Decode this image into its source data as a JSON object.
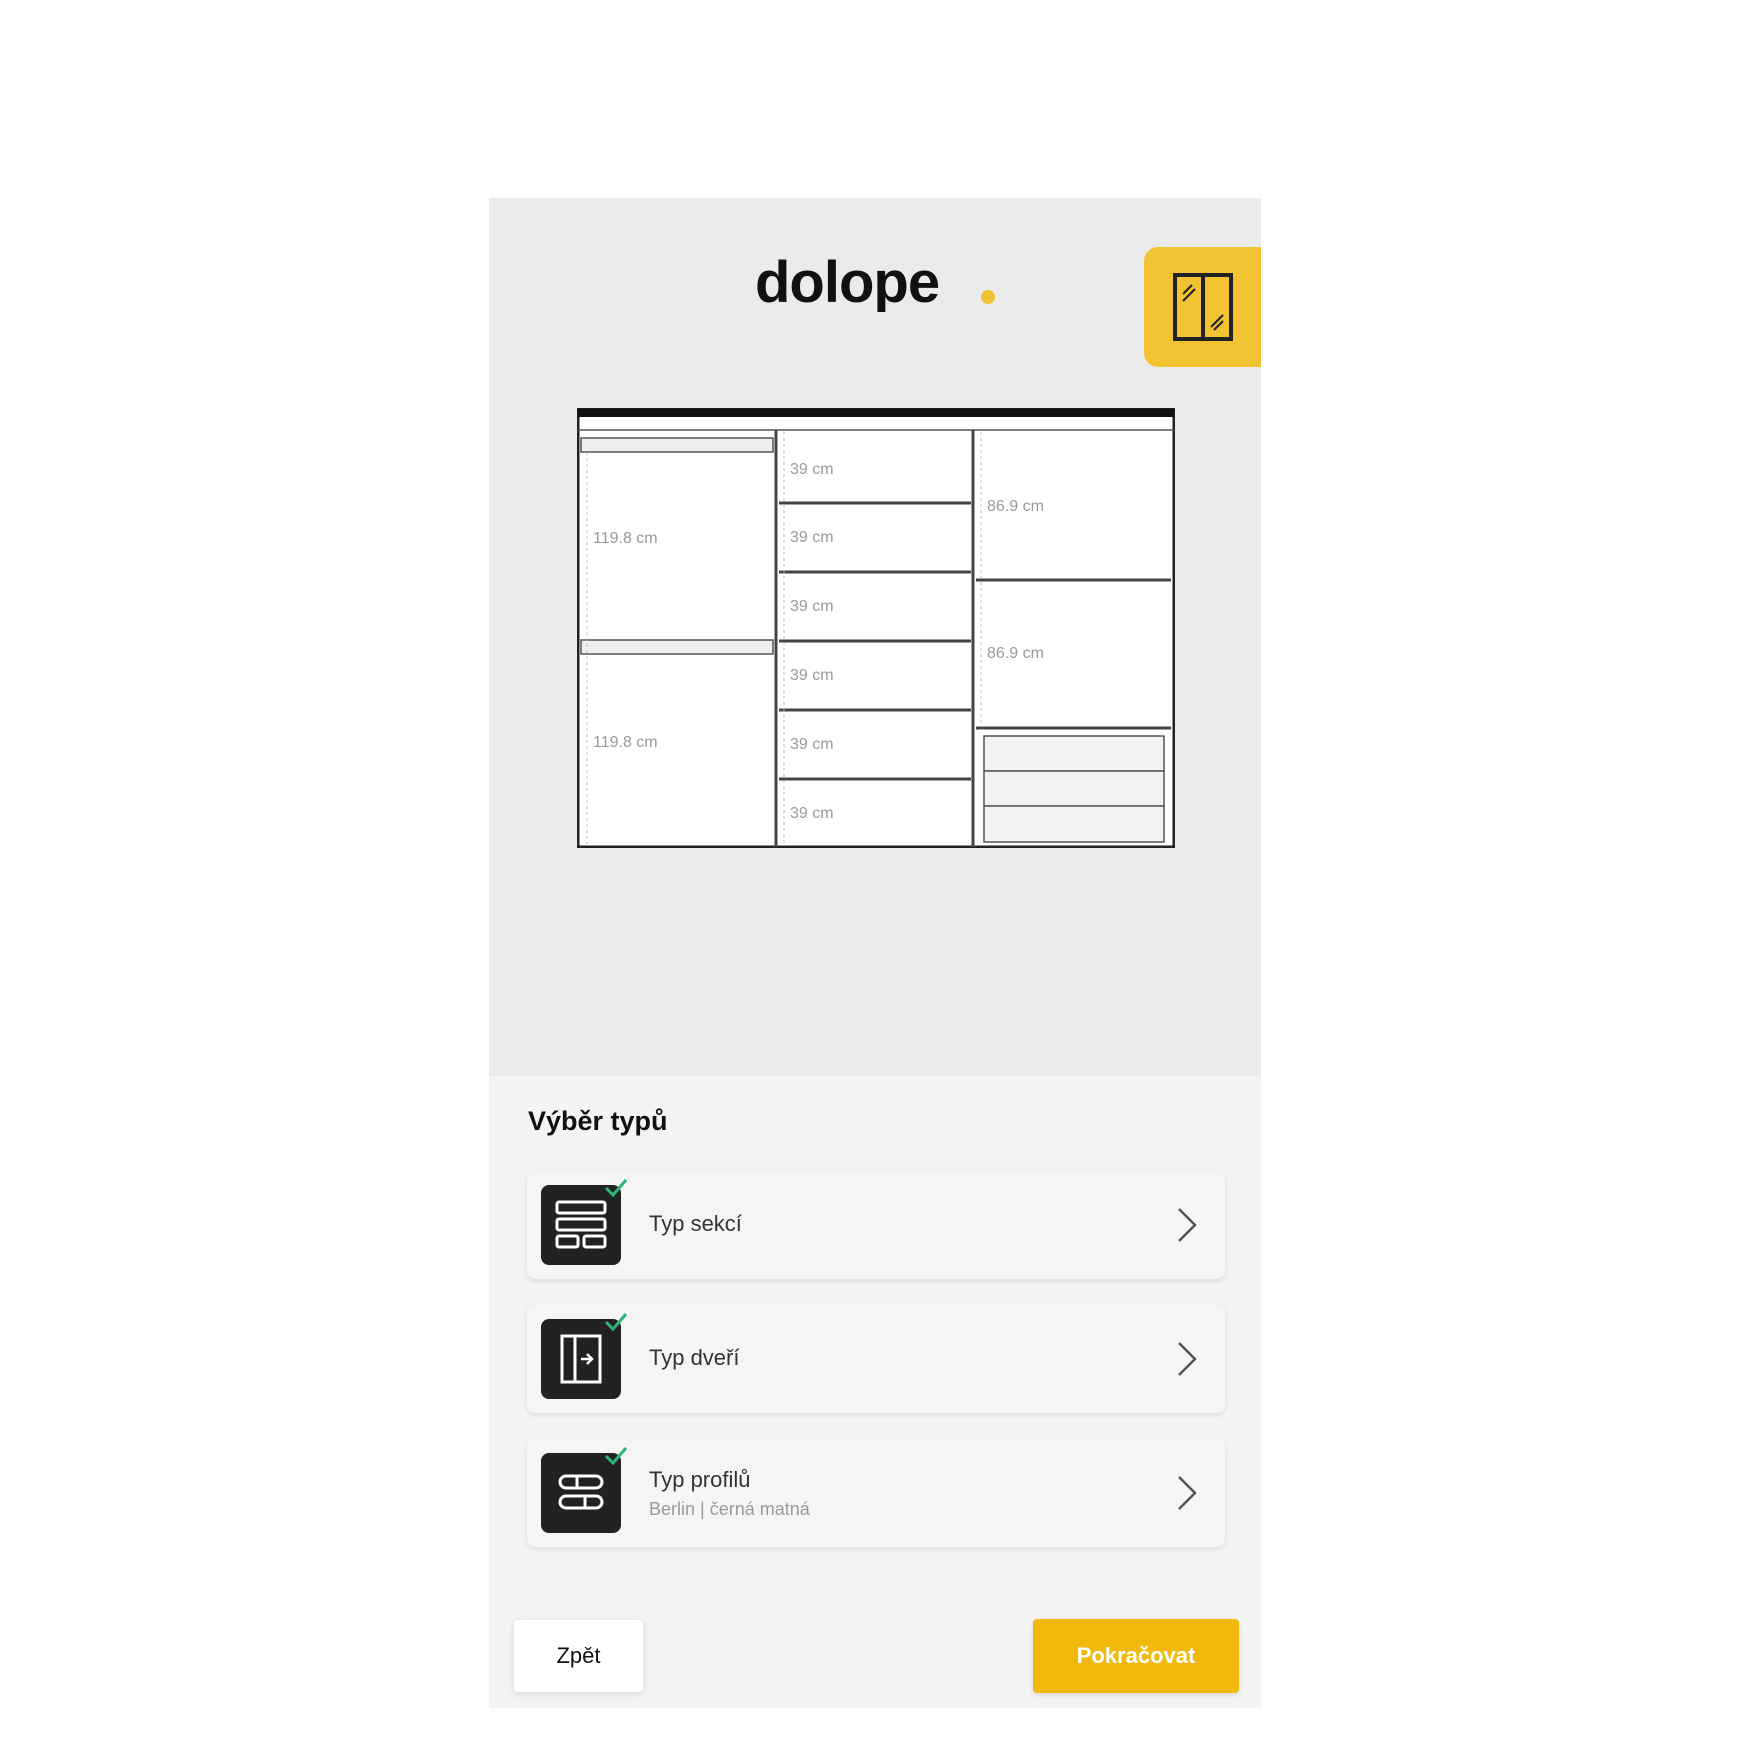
{
  "brand": {
    "name": "dolope",
    "accent": "#f0b90b",
    "dot_color": "#f1c232"
  },
  "header": {
    "door_toggle_icon": "sliding-door-icon"
  },
  "wardrobe": {
    "left_column": [
      "119.8 cm",
      "119.8 cm"
    ],
    "middle_column": [
      "39 cm",
      "39 cm",
      "39 cm",
      "39 cm",
      "39 cm",
      "39 cm"
    ],
    "right_column": [
      "86.9 cm",
      "86.9 cm"
    ],
    "right_drawers": 3
  },
  "panel": {
    "title": "Výběr typů",
    "options": [
      {
        "label": "Typ sekcí",
        "sublabel": "",
        "icon": "sections-icon",
        "completed": true
      },
      {
        "label": "Typ dveří",
        "sublabel": "",
        "icon": "door-icon",
        "completed": true
      },
      {
        "label": "Typ profilů",
        "sublabel": "Berlin | černá matná",
        "icon": "profiles-icon",
        "completed": true
      }
    ]
  },
  "footer": {
    "back_label": "Zpět",
    "continue_label": "Pokračovat"
  },
  "colors": {
    "check": "#2bb673",
    "icon_bg": "#222222"
  }
}
